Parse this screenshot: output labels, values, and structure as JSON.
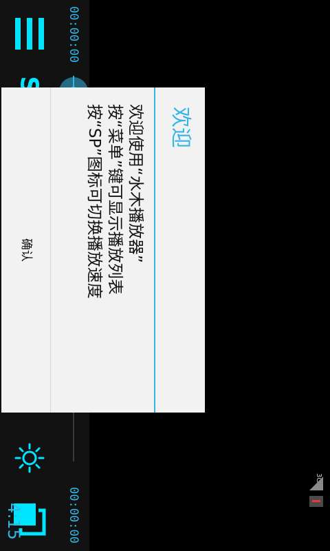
{
  "app": {
    "name": "水木播放器"
  },
  "controls": {
    "menu_icon": "menu-icon",
    "speed_label": "SP",
    "icons": [
      "pin-remove-icon",
      "previous-icon",
      "play-icon",
      "next-icon",
      "pin-add-icon",
      "settings-icon",
      "window-icon"
    ],
    "accent": "#00e5ff"
  },
  "seek": {
    "elapsed": "00:00:00",
    "duration": "00:00:00",
    "progress": 0.0,
    "accent": "#33b5e5"
  },
  "dialog": {
    "title": "欢迎",
    "lines": [
      "欢迎使用“水木播放器”",
      "按“菜单”键可显示播放列表",
      "按“SP”图标可切换播放速度"
    ],
    "ok_label": "确认"
  },
  "status_bar": {
    "time": "4:15",
    "network": "3G"
  }
}
